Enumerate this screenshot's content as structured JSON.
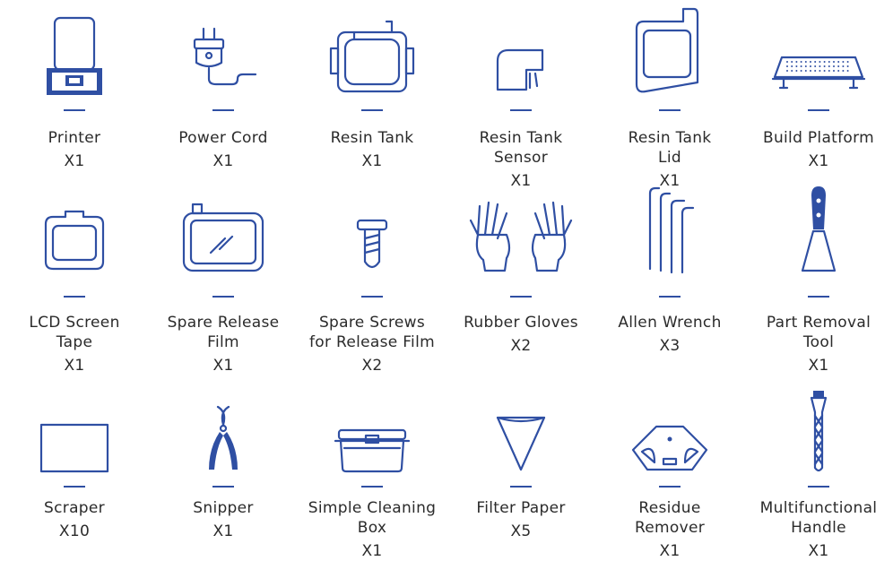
{
  "accent": "#2f4fa3",
  "items": [
    {
      "name": "Printer",
      "lines": [
        "Printer"
      ],
      "qty": "X1",
      "icon": "printer-icon"
    },
    {
      "name": "Power Cord",
      "lines": [
        "Power Cord"
      ],
      "qty": "X1",
      "icon": "power-cord-icon"
    },
    {
      "name": "Resin Tank",
      "lines": [
        "Resin Tank"
      ],
      "qty": "X1",
      "icon": "resin-tank-icon"
    },
    {
      "name": "Resin Tank Sensor",
      "lines": [
        "Resin Tank",
        "Sensor"
      ],
      "qty": "X1",
      "icon": "resin-tank-sensor-icon"
    },
    {
      "name": "Resin Tank Lid",
      "lines": [
        "Resin Tank",
        "Lid"
      ],
      "qty": "X1",
      "icon": "resin-tank-lid-icon"
    },
    {
      "name": "Build Platform",
      "lines": [
        "Build Platform"
      ],
      "qty": "X1",
      "icon": "build-platform-icon"
    },
    {
      "name": "LCD Screen Tape",
      "lines": [
        "LCD Screen",
        "Tape"
      ],
      "qty": "X1",
      "icon": "lcd-screen-tape-icon"
    },
    {
      "name": "Spare Release Film",
      "lines": [
        "Spare Release",
        "Film"
      ],
      "qty": "X1",
      "icon": "release-film-icon"
    },
    {
      "name": "Spare Screws for Release Film",
      "lines": [
        "Spare Screws",
        "for Release Film"
      ],
      "qty": "X2",
      "icon": "screw-icon"
    },
    {
      "name": "Rubber Gloves",
      "lines": [
        "Rubber Gloves"
      ],
      "qty": "X2",
      "icon": "gloves-icon"
    },
    {
      "name": "Allen Wrench",
      "lines": [
        "Allen Wrench"
      ],
      "qty": "X3",
      "icon": "allen-wrench-icon"
    },
    {
      "name": "Part Removal Tool",
      "lines": [
        "Part Removal",
        "Tool"
      ],
      "qty": "X1",
      "icon": "part-removal-tool-icon"
    },
    {
      "name": "Scraper",
      "lines": [
        "Scraper"
      ],
      "qty": "X10",
      "icon": "scraper-icon"
    },
    {
      "name": "Snipper",
      "lines": [
        "Snipper"
      ],
      "qty": "X1",
      "icon": "snipper-icon"
    },
    {
      "name": "Simple Cleaning Box",
      "lines": [
        "Simple Cleaning",
        "Box"
      ],
      "qty": "X1",
      "icon": "cleaning-box-icon"
    },
    {
      "name": "Filter Paper",
      "lines": [
        "Filter Paper"
      ],
      "qty": "X5",
      "icon": "filter-paper-icon"
    },
    {
      "name": "Residue Remover",
      "lines": [
        "Residue",
        "Remover"
      ],
      "qty": "X1",
      "icon": "residue-remover-icon"
    },
    {
      "name": "Multifunctional Handle",
      "lines": [
        "Multifunctional",
        "Handle"
      ],
      "qty": "X1",
      "icon": "multifunctional-handle-icon"
    }
  ]
}
